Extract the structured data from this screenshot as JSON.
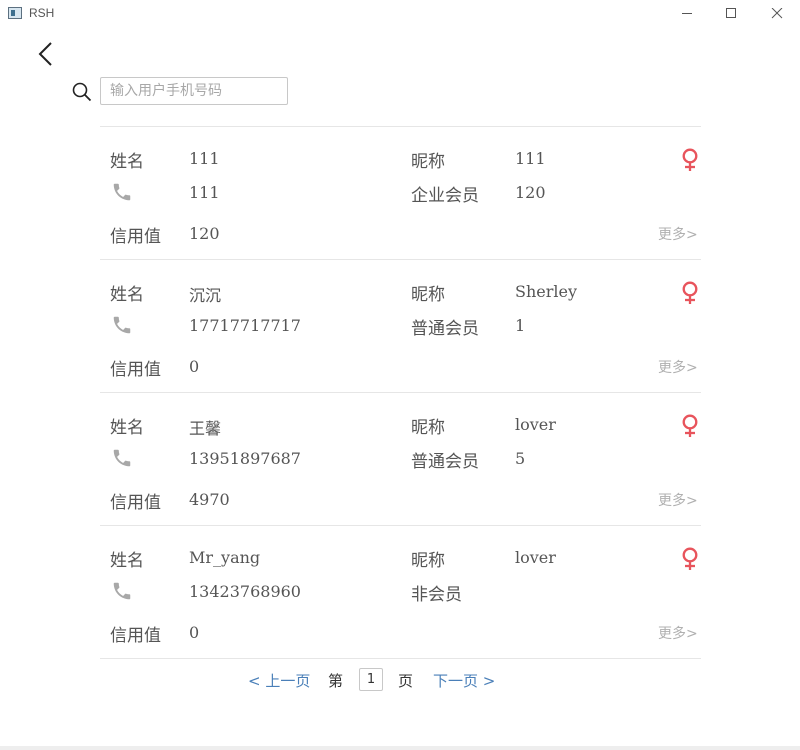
{
  "window": {
    "title": "RSH",
    "controls": [
      "minimize",
      "maximize",
      "close"
    ]
  },
  "header": {
    "back_icon": "chevron-left-icon"
  },
  "search": {
    "icon": "search-icon",
    "placeholder": "输入用户手机号码",
    "value": ""
  },
  "labels": {
    "name": "姓名",
    "nickname": "昵称",
    "credit": "信用值",
    "more": "更多>"
  },
  "users": [
    {
      "name": "111",
      "nickname": "111",
      "phone": "111",
      "member_type": "企业会员",
      "member_value": "120",
      "credit": "120",
      "gender": "female"
    },
    {
      "name": "沉沉",
      "nickname": "Sherley",
      "phone": "17717717717",
      "member_type": "普通会员",
      "member_value": "1",
      "credit": "0",
      "gender": "female"
    },
    {
      "name": "王馨",
      "nickname": "lover",
      "phone": "13951897687",
      "member_type": "普通会员",
      "member_value": "5",
      "credit": "4970",
      "gender": "female"
    },
    {
      "name": "Mr_yang",
      "nickname": "lover",
      "phone": "13423768960",
      "member_type": "非会员",
      "member_value": "",
      "credit": "0",
      "gender": "female"
    }
  ],
  "pagination": {
    "prev": "< 上一页",
    "before": "第",
    "page": "1",
    "after": "页",
    "next": "下一页 >"
  },
  "colors": {
    "female": "#e8545c",
    "link": "#4a7fb8",
    "more": "#b0b0b0",
    "phone_icon": "#a8a8a8"
  }
}
